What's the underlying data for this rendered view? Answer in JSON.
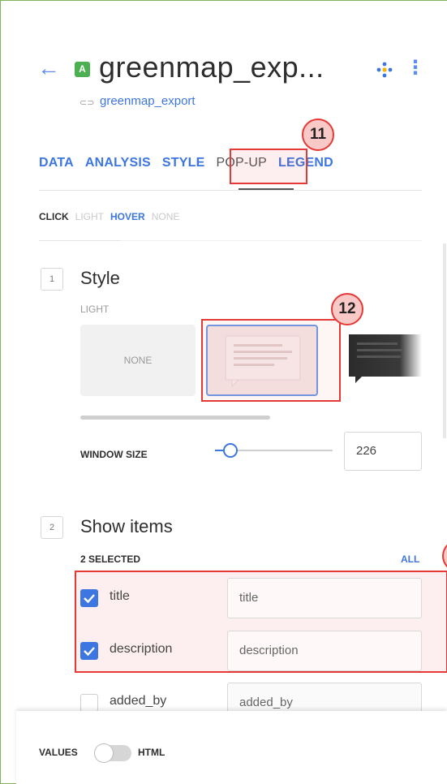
{
  "header": {
    "back_icon": "arrow-left-icon",
    "layer_badge": "A",
    "title": "greenmap_exp...",
    "source_icon": "link-icon",
    "source_name": "greenmap_export",
    "move_icon": "move-icon",
    "more_icon": "kebab-menu-icon"
  },
  "tabs": [
    {
      "label": "DATA"
    },
    {
      "label": "ANALYSIS"
    },
    {
      "label": "STYLE"
    },
    {
      "label": "POP-UP",
      "active": true
    },
    {
      "label": "LEGEND"
    }
  ],
  "callouts": {
    "c11": "11",
    "c12": "12"
  },
  "modes": {
    "click_label": "CLICK",
    "click_value": "LIGHT",
    "hover_label": "HOVER",
    "hover_value": "NONE"
  },
  "style_section": {
    "number": "1",
    "title": "Style",
    "subtitle": "LIGHT",
    "options": [
      {
        "label": "NONE"
      },
      {
        "label": "",
        "selected": true
      },
      {
        "label": ""
      }
    ],
    "window_size_label": "WINDOW SIZE",
    "window_size_value": "226",
    "window_size_slider_fraction": 0.1
  },
  "items_section": {
    "number": "2",
    "title": "Show items",
    "selected_count": "2 SELECTED",
    "all_label": "ALL",
    "items": [
      {
        "name": "title",
        "checked": true,
        "value": "title"
      },
      {
        "name": "description",
        "checked": true,
        "value": "description"
      },
      {
        "name": "added_by",
        "checked": false,
        "value": "added_by"
      }
    ]
  },
  "footer": {
    "values_label": "VALUES",
    "html_label": "HTML"
  },
  "colors": {
    "accent": "#3d76e0",
    "callout_red": "#e53935",
    "layer_green": "#4caf50"
  }
}
